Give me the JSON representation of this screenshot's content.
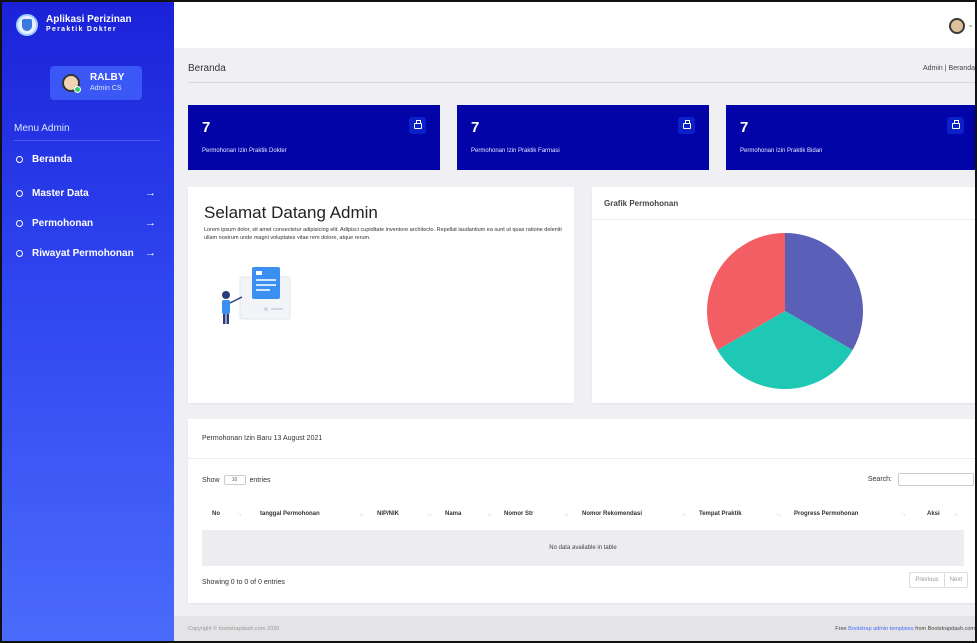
{
  "brand": {
    "title": "Aplikasi Perizinan",
    "subtitle": "Peraktik Dokter"
  },
  "user": {
    "name": "RALBY",
    "role": "Admin CS"
  },
  "sidebar": {
    "header": "Menu Admin",
    "items": [
      {
        "label": "Beranda",
        "arrow": ""
      },
      {
        "label": "Master Data",
        "arrow": "→"
      },
      {
        "label": "Permohonan",
        "arrow": "→"
      },
      {
        "label": "Riwayat Permohonan",
        "arrow": "→"
      }
    ]
  },
  "page": {
    "title": "Beranda",
    "breadcrumb": "Admin  |  Beranda"
  },
  "stats": [
    {
      "value": "7",
      "label": "Permohonan Izin Praktik Dokter",
      "icon": "briefcase-icon"
    },
    {
      "value": "7",
      "label": "Permohonan Izin Praktik Farmasi",
      "icon": "briefcase-icon"
    },
    {
      "value": "7",
      "label": "Permohonan Izin Praktik Bidan",
      "icon": "briefcase-icon"
    }
  ],
  "welcome": {
    "title": "Selamat Datang Admin",
    "text": "Lorem ipsum dolor, sit amet consectetur adipisicing elit. Adipisci cupiditate inventore architecto. Repellat laudantium ea sunt ut quas ratione deleniti ullam nostrum unde magni voluptates vitae rem dolore, atque rerum."
  },
  "chart": {
    "title": "Grafik Permohonan"
  },
  "chart_data": {
    "type": "pie",
    "title": "Grafik Permohonan",
    "slices": [
      {
        "value": 7,
        "color": "#5a5fb8"
      },
      {
        "value": 7,
        "color": "#1ec8b4"
      },
      {
        "value": 7,
        "color": "#f25e63"
      }
    ]
  },
  "table": {
    "title": "Permohonan Izin Baru 13 August 2021",
    "show_prefix": "Show",
    "show_value": "10",
    "show_suffix": "entries",
    "search_label": "Search:",
    "columns": [
      "No",
      "tanggal Permohonan",
      "NIP/NIK",
      "Nama",
      "Nomor Str",
      "Nomor Rekomendasi",
      "Tempat Praktik",
      "Progress Permohonan",
      "Aksi"
    ],
    "empty": "No data available in table",
    "info": "Showing 0 to 0 of 0 entries",
    "prev": "Previous",
    "next": "Next"
  },
  "footer": {
    "copyright": "Copyright © bootstrapdash.com 2020",
    "credit_prefix": "Free",
    "credit_link": "Bootstrap admin templates",
    "credit_suffix": "from Bootstrapdash.com"
  }
}
